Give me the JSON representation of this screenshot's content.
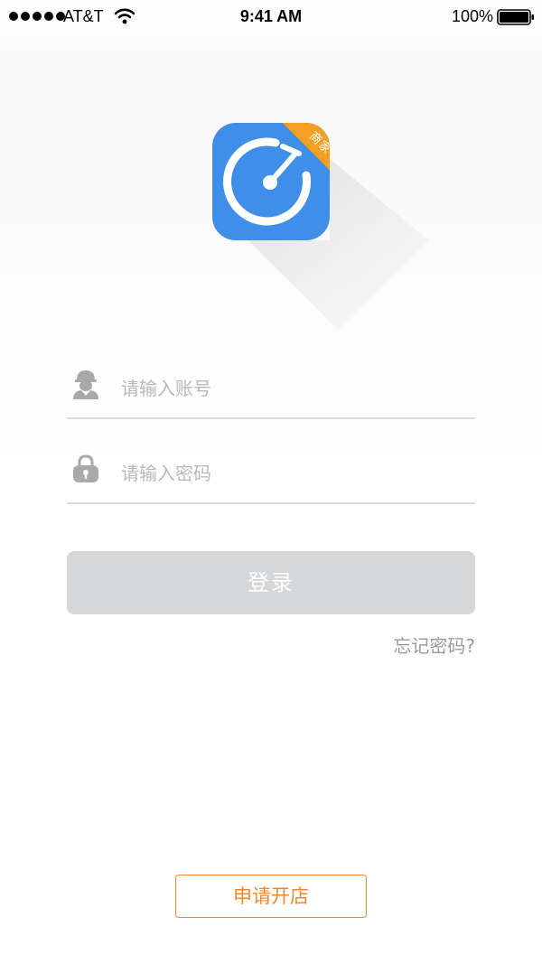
{
  "status_bar": {
    "carrier": "AT&T",
    "time": "9:41 AM",
    "battery_percent": "100%",
    "icons": [
      "signal-dots-icon",
      "wifi-icon",
      "battery-icon"
    ]
  },
  "logo": {
    "badge_text": "商家",
    "colors": {
      "background": "#3f8ee8",
      "badge": "#f5a022"
    }
  },
  "login_form": {
    "account": {
      "placeholder": "请输入账号",
      "value": "",
      "icon": "worker-avatar-icon"
    },
    "password": {
      "placeholder": "请输入密码",
      "value": "",
      "icon": "lock-icon"
    },
    "login_label": "登录",
    "forgot_label": "忘记密码?"
  },
  "apply_label": "申请开店",
  "colors": {
    "accent": "#f0882a",
    "login_disabled": "#d6d7d9"
  }
}
